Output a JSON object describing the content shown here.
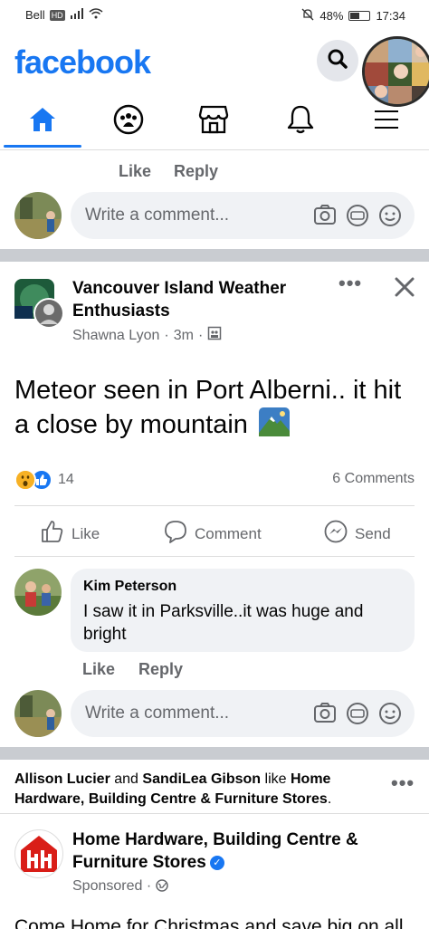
{
  "status_bar": {
    "carrier": "Bell",
    "hd": "HD",
    "battery_percent": "48%",
    "battery_level": 0.48,
    "time": "17:34"
  },
  "header": {
    "logo": "facebook"
  },
  "nav": {
    "tabs": [
      "home-icon",
      "groups-icon",
      "marketplace-icon",
      "notifications-icon",
      "menu-icon"
    ],
    "active_tab": "home-icon",
    "accent": "#1877f2"
  },
  "prev_post": {
    "like_label": "Like",
    "reply_label": "Reply",
    "comment_placeholder": "Write a comment..."
  },
  "post": {
    "group_name": "Vancouver Island Weather Enthusiasts",
    "author": "Shawna Lyon",
    "time": "3m",
    "meta_sep": "·",
    "body": "Meteor seen in Port Alberni.. it hit a close by mountain",
    "reaction_count": "14",
    "comments_count": "6 Comments",
    "actions": {
      "like": "Like",
      "comment": "Comment",
      "send": "Send"
    },
    "comment": {
      "author": "Kim Peterson",
      "text": "I saw it in Parksville..it was huge and bright",
      "like_label": "Like",
      "reply_label": "Reply"
    },
    "comment_placeholder": "Write a comment..."
  },
  "activity": {
    "user1": "Allison Lucier",
    "and": " and ",
    "user2": "SandiLea Gibson",
    "like_word": " like ",
    "page": "Home Hardware, Building Centre & Furniture Stores",
    "period": "."
  },
  "ad": {
    "title": "Home Hardware, Building Centre & Furniture Stores",
    "sponsored": "Sponsored",
    "meta_sep": "·",
    "body": "Come Home for Christmas and save big on all"
  }
}
